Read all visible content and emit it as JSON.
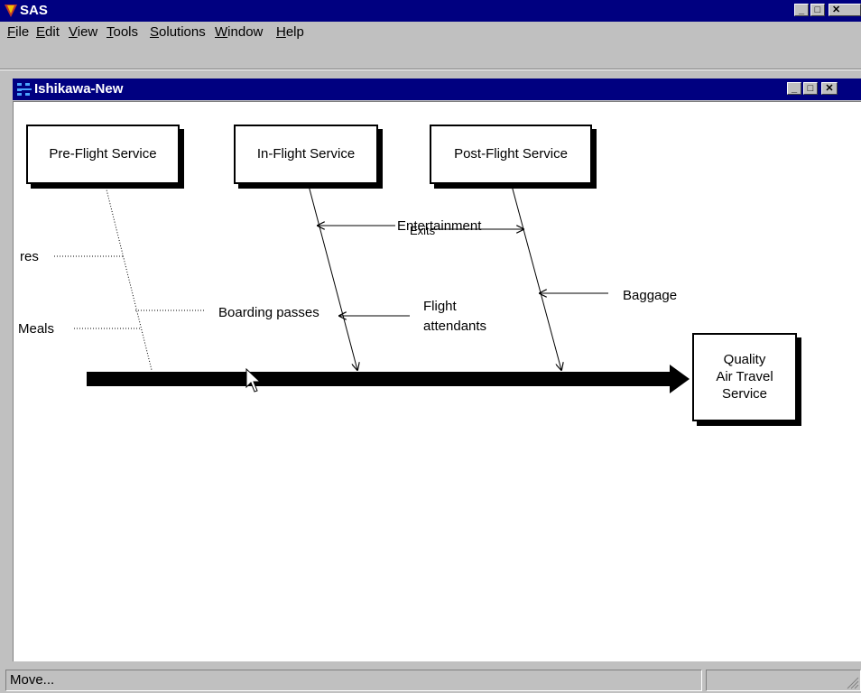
{
  "app": {
    "title": "SAS",
    "menu": [
      {
        "prefix": "",
        "underline": "F",
        "rest": "ile"
      },
      {
        "prefix": "",
        "underline": "E",
        "rest": "dit"
      },
      {
        "prefix": "",
        "underline": "V",
        "rest": "iew"
      },
      {
        "prefix": "",
        "underline": "T",
        "rest": "ools"
      },
      {
        "prefix": "",
        "underline": "S",
        "rest": "olutions"
      },
      {
        "prefix": "",
        "underline": "W",
        "rest": "indow"
      },
      {
        "prefix": "",
        "underline": "H",
        "rest": "elp"
      }
    ]
  },
  "child": {
    "title": "Ishikawa-New"
  },
  "diagram": {
    "categories": {
      "pre": "Pre-Flight Service",
      "in": "In-Flight Service",
      "post": "Post-Flight Service"
    },
    "effect": [
      "Quality",
      "Air Travel",
      "Service"
    ],
    "causes": {
      "res": "res",
      "meals": "Meals",
      "boarding": "Boarding passes",
      "entertainment": "Entertainment",
      "exits": "Exits",
      "flight": "Flight",
      "attendants": "attendants",
      "baggage": "Baggage"
    }
  },
  "status": {
    "text": "Move..."
  },
  "colors": {
    "titlebar": "#000080",
    "chrome": "#c0c0c0",
    "canvas": "#ffffff"
  }
}
